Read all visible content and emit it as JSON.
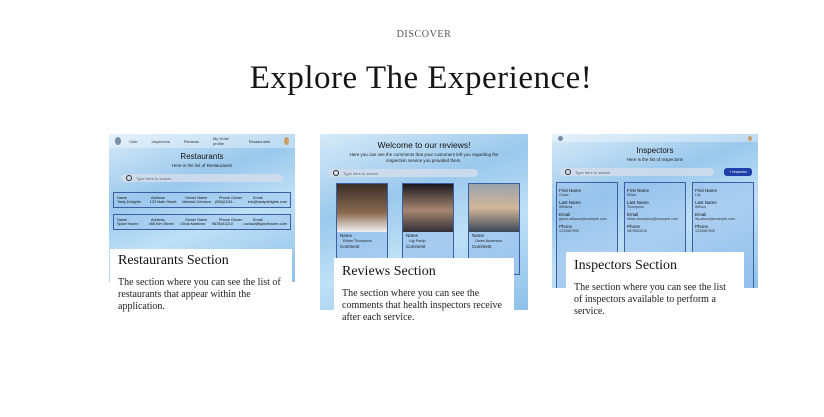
{
  "eyebrow": "DISCOVER",
  "headline": "Explore The Experience!",
  "restaurants": {
    "nav": [
      "Club",
      "Inspectors",
      "Reviews",
      "My Hotel profile",
      "Restaurants"
    ],
    "title": "Restaurants",
    "subtitle": "Here is the list of Restaurants!",
    "search_placeholder": "Type here to search",
    "columns": [
      "Name",
      "Address",
      "Owner Name",
      "Phone Owner",
      "Email"
    ],
    "rows": [
      [
        "Tasty Delights",
        "123 Main Street",
        "Michael Johnson",
        "(555)1234...",
        "info@tastydelights.com"
      ],
      [
        "Spice Haven",
        "456 Elm Street",
        "Olivia Martinez",
        "9876543210",
        "contact@spicehaven.com"
      ]
    ],
    "caption_title": "Restaurants Section",
    "caption_text": "The section where you can see the list of restaurants that appear within the application."
  },
  "reviews": {
    "title": "Welcome to our reviews!",
    "subtitle": "Here you can see the comments that your customers left you regarding the inspection service you provided them.",
    "cards": [
      {
        "name_label": "Name",
        "name": "Ethan Thompson",
        "comment_label": "Comment",
        "photo_bg": "#6c5a48"
      },
      {
        "name_label": "Name",
        "name": "Lily Parkp",
        "comment_label": "Comment",
        "photo_bg": "#2e2c33"
      },
      {
        "name_label": "Name",
        "name": "Owen Anderson",
        "comment_label": "Comment",
        "photo_bg": "#7d858e"
      }
    ],
    "caption_title": "Reviews Section",
    "caption_text": "The section where you can see the comments that health inspectors receive after each service."
  },
  "inspectors": {
    "title": "Inspectors",
    "subtitle": "Here is the list of Inspectors!",
    "search_placeholder": "Type here to search",
    "add_label": "+ Inspector",
    "cards": [
      {
        "first_label": "First Name",
        "first": "Grace",
        "last_label": "Last Name",
        "last": "Williams",
        "email_label": "Email",
        "email": "grace.williams@example.com",
        "phone_label": "Phone",
        "phone": "1234567890"
      },
      {
        "first_label": "First Name",
        "first": "Ethan",
        "last_label": "Last Name",
        "last": "Thompson",
        "email_label": "Email",
        "email": "ethan.thompson@example.com",
        "phone_label": "Phone",
        "phone": "9876543210"
      },
      {
        "first_label": "First Name",
        "first": "Lily",
        "last_label": "Last Name",
        "last": "Wilson",
        "email_label": "Email",
        "email": "lily.wilson@example.com",
        "phone_label": "Phone",
        "phone": "1234567890"
      }
    ],
    "caption_title": "Inspectors Section",
    "caption_text": "The section where you can see the list of inspectors available to perform a service."
  }
}
